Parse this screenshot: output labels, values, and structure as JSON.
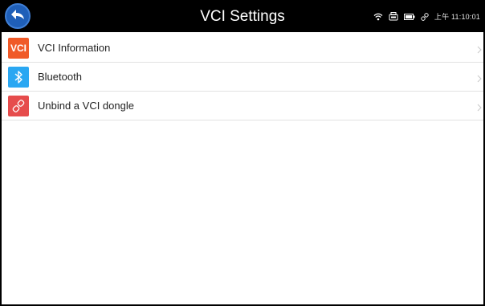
{
  "header": {
    "title": "VCI Settings",
    "back_icon": "back-arrow-icon",
    "status": {
      "icons": [
        "wifi-icon",
        "vci-dongle-icon",
        "battery-icon",
        "link-icon"
      ],
      "time": "上午 11:10:01"
    }
  },
  "menu": {
    "items": [
      {
        "label": "VCI Information",
        "icon_text": "VCI",
        "icon": "vci-icon",
        "color": "#f05a28"
      },
      {
        "label": "Bluetooth",
        "icon": "bluetooth-icon",
        "color": "#2aa7f2"
      },
      {
        "label": "Unbind a VCI dongle",
        "icon": "unlink-icon",
        "color": "#e64c4c"
      }
    ]
  },
  "colors": {
    "topbar": "#000000",
    "back_button": "#1f5fb8",
    "background": "#ffffff",
    "divider": "#e2e2e2"
  }
}
